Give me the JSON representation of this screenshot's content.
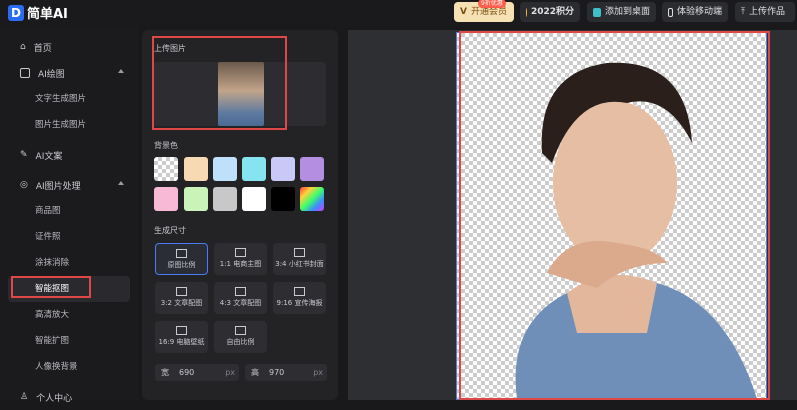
{
  "app": {
    "logo_letter": "D",
    "name": "简单AI"
  },
  "topbar": {
    "vip": "开通会员",
    "vip_badge": "9折优惠",
    "points": "2022积分",
    "add_desktop": "添加到桌面",
    "mobile": "体验移动端",
    "upload_work": "上传作品"
  },
  "sidebar": {
    "home": "首页",
    "ai_draw": "AI绘图",
    "text_to_image": "文字生成图片",
    "image_to_image": "图片生成图片",
    "ai_copy": "AI文案",
    "ai_image_process": "AI图片处理",
    "product_image": "商品图",
    "id_photo": "证件照",
    "erase": "涂抹消除",
    "smart_cutout": "智能抠图",
    "hd_upscale": "高清放大",
    "smart_expand": "智能扩图",
    "portrait_bg": "人像换背景",
    "personal_center": "个人中心"
  },
  "panel": {
    "upload_label": "上传图片",
    "bg_label": "背景色",
    "size_label": "生成尺寸",
    "sizes": [
      "原图比例",
      "1:1 电商主图",
      "3:4 小红书封面",
      "3:2 文章配图",
      "4:3 文章配图",
      "9:16 宣传海报",
      "16:9 电脑壁纸",
      "自由比例"
    ],
    "width_label": "宽",
    "width_value": "690",
    "height_label": "高",
    "height_value": "970",
    "unit": "px"
  },
  "colors": {
    "swatches": [
      "transparent",
      "#f7d9b4",
      "#bfe0fb",
      "#86e3f0",
      "#c9c9f7",
      "#b48ee0",
      "#f7b9d6",
      "#c9f3b8",
      "#c8c8c8",
      "#ffffff",
      "#000000",
      "rainbow"
    ]
  }
}
